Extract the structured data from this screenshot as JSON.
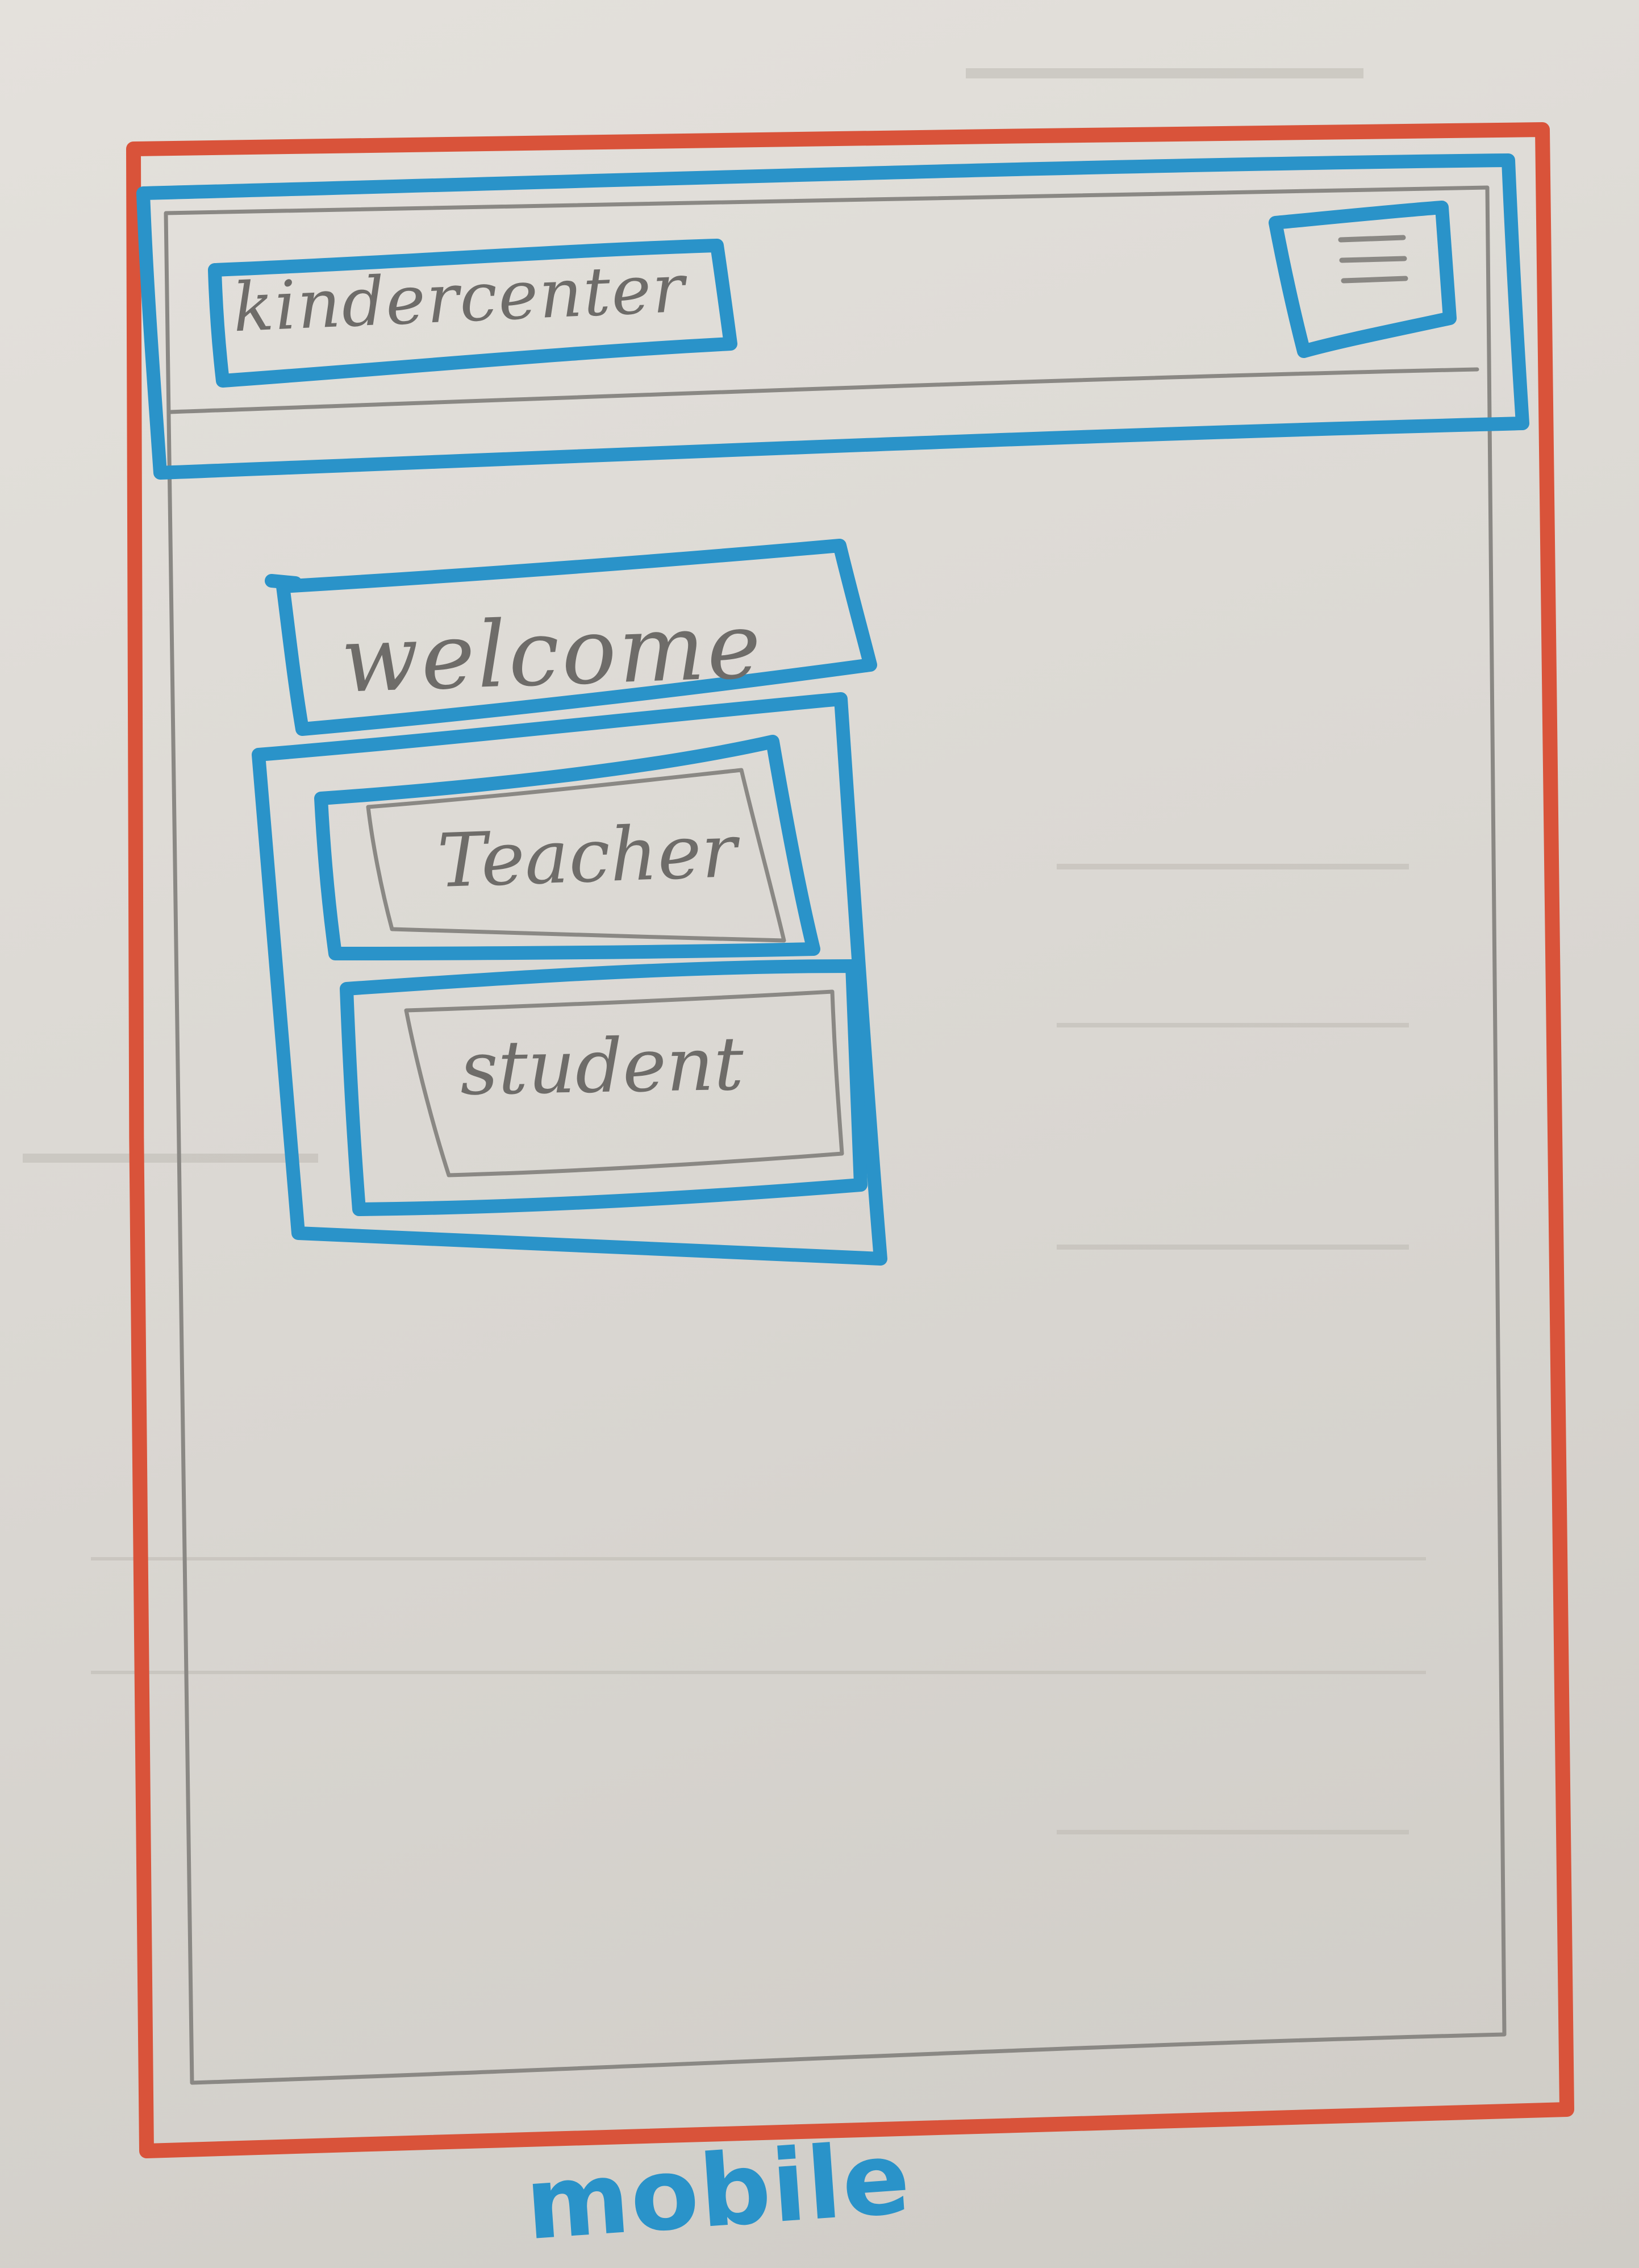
{
  "sketch": {
    "header": {
      "logo_text": "kindercenter",
      "menu_icon": "hamburger-menu-icon"
    },
    "welcome_text": "welcome",
    "buttons": {
      "teacher_label": "Teacher",
      "student_label": "student"
    },
    "caption": "mobile"
  },
  "colors": {
    "paper": "#dedbd6",
    "red_marker": "#d9533a",
    "blue_marker": "#2a93c9",
    "pencil": "#8a8884"
  }
}
